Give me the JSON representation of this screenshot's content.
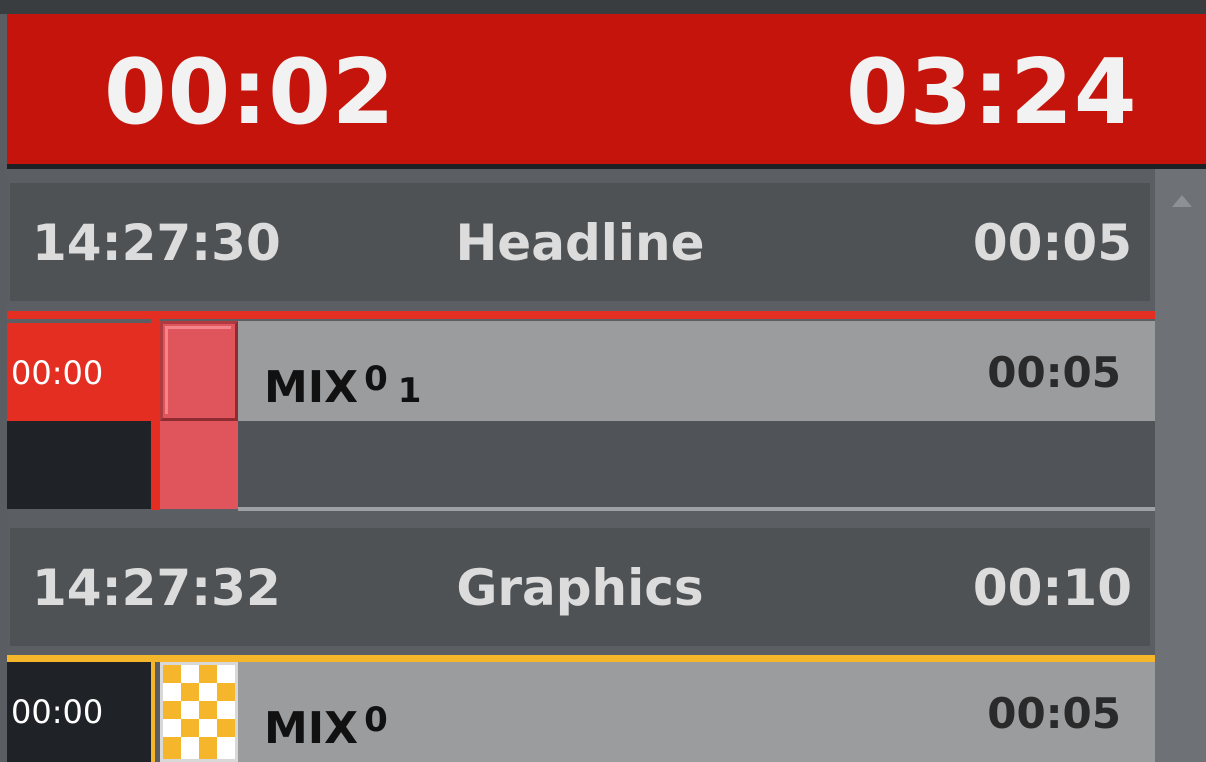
{
  "timers": {
    "elapsed": "00:02",
    "remaining": "03:24"
  },
  "colors": {
    "timer_bar": "#c5140b",
    "onair": "#e42e22",
    "next": "#f5b62c"
  },
  "stories": [
    {
      "time": "14:27:30",
      "title": "Headline",
      "duration": "00:05"
    },
    {
      "time": "14:27:32",
      "title": "Graphics",
      "duration": "00:10"
    }
  ],
  "elements": [
    {
      "time": "00:00",
      "name": "MIX",
      "source": "0",
      "extra": "1",
      "duration": "00:05",
      "state": "on-air"
    },
    {
      "time": "00:00",
      "name": "MIX",
      "source": "0",
      "extra": "",
      "duration": "00:05",
      "state": "next"
    }
  ]
}
